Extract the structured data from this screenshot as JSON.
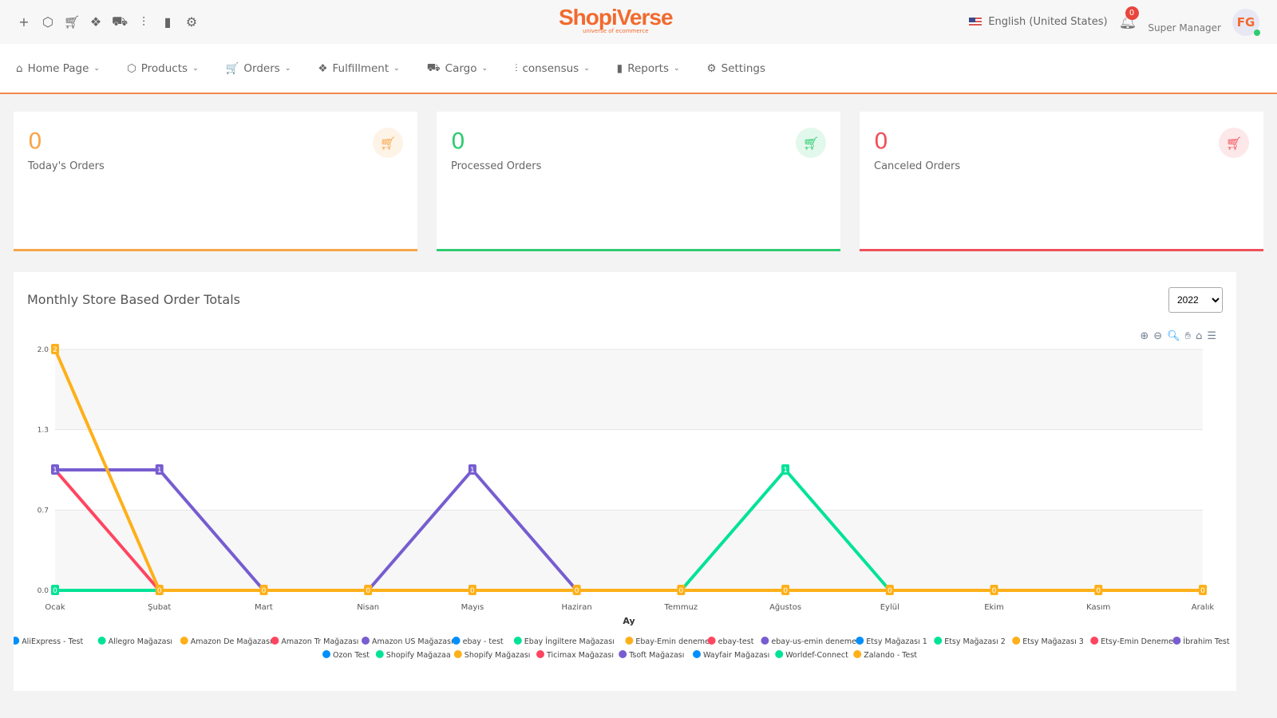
{
  "topbar": {
    "icons": [
      "plus-icon",
      "box-icon",
      "cart-icon",
      "fulfillment-icon",
      "truck-icon",
      "sliders-icon",
      "bar-chart-icon",
      "gear-icon"
    ],
    "logo": {
      "name": "ShopiVerse",
      "slogan": "universe of ecommerce"
    },
    "language": "English (United States)",
    "notifications": "0",
    "role": "Super Manager",
    "avatar": "FG"
  },
  "nav": [
    {
      "label": "Home Page",
      "icon": "⌂"
    },
    {
      "label": "Products",
      "icon": "⬡"
    },
    {
      "label": "Orders",
      "icon": "🛒"
    },
    {
      "label": "Fulfillment",
      "icon": "❖"
    },
    {
      "label": "Cargo",
      "icon": "⛟"
    },
    {
      "label": "consensus",
      "icon": "⫶"
    },
    {
      "label": "Reports",
      "icon": "▮"
    },
    {
      "label": "Settings",
      "icon": "⚙"
    }
  ],
  "cards": [
    {
      "value": "0",
      "label": "Today's Orders",
      "color": "#f7a54a"
    },
    {
      "value": "0",
      "label": "Processed Orders",
      "color": "#2ecc71"
    },
    {
      "value": "0",
      "label": "Canceled Orders",
      "color": "#f0505a"
    }
  ],
  "chart": {
    "title": "Monthly Store Based Order Totals",
    "year": "2022",
    "year_options": [
      "2022"
    ]
  },
  "chart_data": {
    "type": "line",
    "xlabel": "Ay",
    "ylabel": "",
    "ylim": [
      0,
      2
    ],
    "yticks": [
      "0.0",
      "0.7",
      "1.3",
      "2.0"
    ],
    "legend": "bottom",
    "grid": true,
    "categories": [
      "Ocak",
      "Şubat",
      "Mart",
      "Nisan",
      "Mayıs",
      "Haziran",
      "Temmuz",
      "Ağustos",
      "Eylül",
      "Ekim",
      "Kasım",
      "Aralık"
    ],
    "series": [
      {
        "name": "AliExpress - Test",
        "color": "#008FFB",
        "values": [
          0,
          0,
          0,
          0,
          0,
          0,
          0,
          0,
          0,
          0,
          0,
          0
        ]
      },
      {
        "name": "Allegro Mağazası",
        "color": "#00E396",
        "values": [
          0,
          0,
          0,
          0,
          0,
          0,
          0,
          0,
          0,
          0,
          0,
          0
        ]
      },
      {
        "name": "Amazon De Mağazası",
        "color": "#FEB019",
        "values": [
          2,
          0,
          0,
          0,
          0,
          0,
          0,
          0,
          0,
          0,
          0,
          0
        ]
      },
      {
        "name": "Amazon Tr Mağazası",
        "color": "#FF4560",
        "values": [
          1,
          0,
          0,
          0,
          0,
          0,
          0,
          0,
          0,
          0,
          0,
          0
        ]
      },
      {
        "name": "Amazon US Mağazası",
        "color": "#775DD0",
        "values": [
          1,
          1,
          0,
          0,
          1,
          0,
          0,
          0,
          0,
          0,
          0,
          0
        ]
      },
      {
        "name": "ebay - test",
        "color": "#008FFB",
        "values": [
          0,
          0,
          0,
          0,
          0,
          0,
          0,
          0,
          0,
          0,
          0,
          0
        ]
      },
      {
        "name": "Ebay İngiltere Mağazası",
        "color": "#00E396",
        "values": [
          0,
          0,
          0,
          0,
          0,
          0,
          0,
          1,
          0,
          0,
          0,
          0
        ]
      },
      {
        "name": "Ebay-Emin deneme",
        "color": "#FEB019",
        "values": [
          0,
          0,
          0,
          0,
          0,
          0,
          0,
          0,
          0,
          0,
          0,
          0
        ]
      },
      {
        "name": "ebay-test",
        "color": "#FF4560",
        "values": [
          0,
          0,
          0,
          0,
          0,
          0,
          0,
          0,
          0,
          0,
          0,
          0
        ]
      },
      {
        "name": "ebay-us-emin deneme",
        "color": "#775DD0",
        "values": [
          0,
          0,
          0,
          0,
          0,
          0,
          0,
          0,
          0,
          0,
          0,
          0
        ]
      },
      {
        "name": "Etsy Mağazası 1",
        "color": "#008FFB",
        "values": [
          0,
          0,
          0,
          0,
          0,
          0,
          0,
          0,
          0,
          0,
          0,
          0
        ]
      },
      {
        "name": "Etsy Mağazası 2",
        "color": "#00E396",
        "values": [
          0,
          0,
          0,
          0,
          0,
          0,
          0,
          0,
          0,
          0,
          0,
          0
        ]
      },
      {
        "name": "Etsy Mağazası 3",
        "color": "#FEB019",
        "values": [
          0,
          0,
          0,
          0,
          0,
          0,
          0,
          0,
          0,
          0,
          0,
          0
        ]
      },
      {
        "name": "Etsy-Emin Deneme",
        "color": "#FF4560",
        "values": [
          0,
          0,
          0,
          0,
          0,
          0,
          0,
          0,
          0,
          0,
          0,
          0
        ]
      },
      {
        "name": "İbrahim Test",
        "color": "#775DD0",
        "values": [
          0,
          0,
          0,
          0,
          0,
          0,
          0,
          0,
          0,
          0,
          0,
          0
        ]
      },
      {
        "name": "Ozon Test",
        "color": "#008FFB",
        "values": [
          0,
          0,
          0,
          0,
          0,
          0,
          0,
          0,
          0,
          0,
          0,
          0
        ]
      },
      {
        "name": "Shopify Mağazaa",
        "color": "#00E396",
        "values": [
          0,
          0,
          0,
          0,
          0,
          0,
          0,
          0,
          0,
          0,
          0,
          0
        ]
      },
      {
        "name": "Shopify Mağazası",
        "color": "#FEB019",
        "values": [
          0,
          0,
          0,
          0,
          0,
          0,
          0,
          0,
          0,
          0,
          0,
          0
        ]
      },
      {
        "name": "Ticimax Mağazası",
        "color": "#FF4560",
        "values": [
          0,
          0,
          0,
          0,
          0,
          0,
          0,
          0,
          0,
          0,
          0,
          0
        ]
      },
      {
        "name": "Tsoft Mağazası",
        "color": "#775DD0",
        "values": [
          0,
          0,
          0,
          0,
          0,
          0,
          0,
          0,
          0,
          0,
          0,
          0
        ]
      },
      {
        "name": "Wayfair Mağazası",
        "color": "#008FFB",
        "values": [
          0,
          0,
          0,
          0,
          0,
          0,
          0,
          0,
          0,
          0,
          0,
          0
        ]
      },
      {
        "name": "Worldef-Connect",
        "color": "#00E396",
        "values": [
          0,
          0,
          0,
          0,
          0,
          0,
          0,
          0,
          0,
          0,
          0,
          0
        ]
      },
      {
        "name": "Zalando - Test",
        "color": "#FEB019",
        "values": [
          0,
          0,
          0,
          0,
          0,
          0,
          0,
          0,
          0,
          0,
          0,
          0
        ]
      }
    ]
  }
}
